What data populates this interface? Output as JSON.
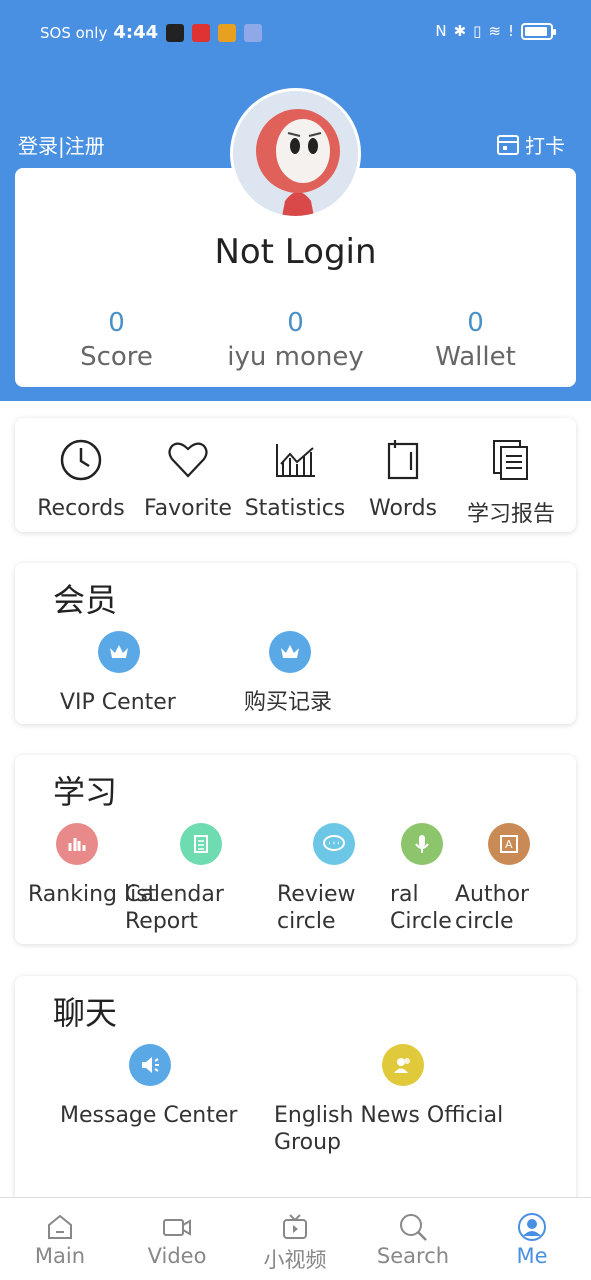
{
  "status_bar": {
    "carrier": "SOS only",
    "time": "4:44"
  },
  "header": {
    "login": "登录|注册",
    "checkin": "打卡"
  },
  "profile": {
    "name": "Not Login",
    "stats": [
      {
        "value": "0",
        "label": "Score"
      },
      {
        "value": "0",
        "label": "iyu money"
      },
      {
        "value": "0",
        "label": "Wallet"
      }
    ]
  },
  "quick": [
    {
      "label": "Records",
      "icon": "clock-icon"
    },
    {
      "label": "Favorite",
      "icon": "heart-icon"
    },
    {
      "label": "Statistics",
      "icon": "chart-icon"
    },
    {
      "label": "Words",
      "icon": "notebook-icon"
    },
    {
      "label": "学习报告",
      "icon": "report-icon"
    }
  ],
  "member": {
    "title": "会员",
    "items": [
      {
        "label": "VIP Center",
        "icon": "crown-icon",
        "color": "#5aa9e6"
      },
      {
        "label": "购买记录",
        "icon": "crown-icon",
        "color": "#5aa9e6"
      }
    ]
  },
  "study": {
    "title": "学习",
    "items": [
      {
        "label": "Ranking list",
        "icon": "bar-chart-icon",
        "color": "#e88a8a"
      },
      {
        "label": "Calendar Report",
        "icon": "clipboard-icon",
        "color": "#6fdbb0"
      },
      {
        "label": "Review circle",
        "icon": "chat-bubble-icon",
        "color": "#6cc7e6"
      },
      {
        "label": "ral Circle",
        "icon": "microphone-icon",
        "color": "#8cc56c"
      },
      {
        "label": "Author circle",
        "icon": "author-icon",
        "color": "#c98a55"
      }
    ]
  },
  "chat": {
    "title": "聊天",
    "items": [
      {
        "label": "Message Center",
        "icon": "speaker-icon",
        "color": "#5aa9e6"
      },
      {
        "label": "English News Official Group",
        "icon": "group-icon",
        "color": "#e0c93a"
      }
    ]
  },
  "tabs": [
    {
      "label": "Main",
      "icon": "home-icon"
    },
    {
      "label": "Video",
      "icon": "video-icon"
    },
    {
      "label": "小视频",
      "icon": "tv-icon"
    },
    {
      "label": "Search",
      "icon": "search-icon"
    },
    {
      "label": "Me",
      "icon": "user-icon",
      "active": true
    }
  ],
  "colors": {
    "primary": "#4a90e2",
    "stat_number": "#4a90c8"
  }
}
